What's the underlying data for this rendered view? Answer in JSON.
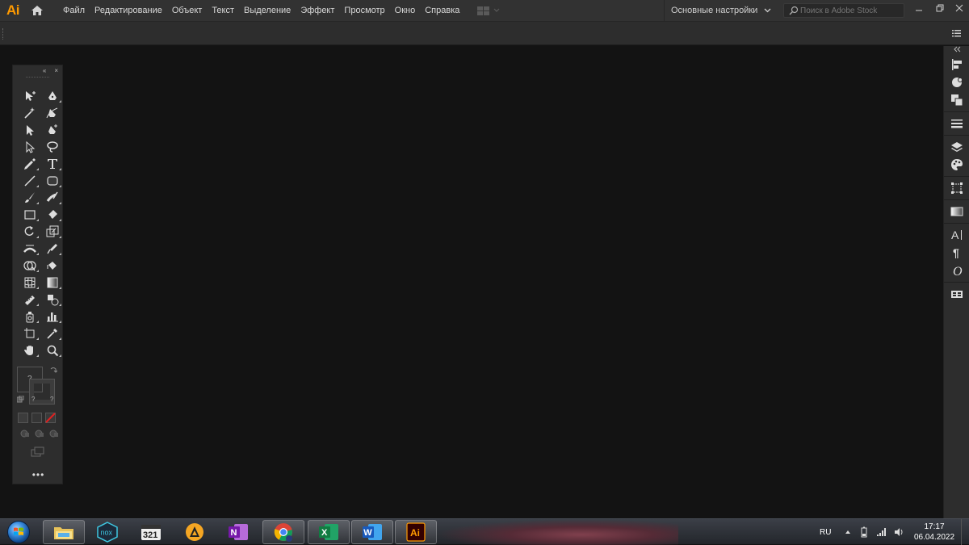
{
  "app": {
    "logo": "Ai",
    "menu": [
      "Файл",
      "Редактирование",
      "Объект",
      "Текст",
      "Выделение",
      "Эффект",
      "Просмотр",
      "Окно",
      "Справка"
    ],
    "workspace_label": "Основные настройки",
    "stock_search_placeholder": "Поиск в Adobe Stock",
    "window_controls": [
      "minimize",
      "restore",
      "close"
    ]
  },
  "tools": {
    "header_collapse": "«",
    "header_close": "×",
    "rows": [
      [
        "selection-tool-icon",
        "pen-tool-icon"
      ],
      [
        "magic-wand-tool-icon",
        "curvature-tool-icon"
      ],
      [
        "direct-selection-tool-icon",
        "add-anchor-point-tool-icon"
      ],
      [
        "group-selection-tool-icon",
        "lasso-tool-icon"
      ],
      [
        "pencil-tool-icon",
        "type-tool-icon"
      ],
      [
        "line-segment-tool-icon",
        "rounded-rectangle-tool-icon"
      ],
      [
        "paintbrush-tool-icon",
        "blob-brush-tool-icon"
      ],
      [
        "rectangle-tool-icon",
        "eraser-tool-icon"
      ],
      [
        "rotate-tool-icon",
        "scale-tool-icon"
      ],
      [
        "width-tool-icon",
        "puppet-warp-tool-icon"
      ],
      [
        "shape-builder-tool-icon",
        "live-paint-bucket-tool-icon"
      ],
      [
        "mesh-tool-icon",
        "gradient-tool-icon"
      ],
      [
        "measure-tool-icon",
        "blend-tool-icon"
      ],
      [
        "symbol-sprayer-tool-icon",
        "column-graph-tool-icon"
      ],
      [
        "artboard-tool-icon",
        "eyedropper-tool-icon"
      ],
      [
        "hand-tool-icon",
        "zoom-tool-icon"
      ]
    ],
    "fill_placeholder": "?",
    "stroke_placeholder": "?",
    "more_label": "•••"
  },
  "taskbar": {
    "apps": [
      "windows-explorer",
      "nox",
      "media-player-321",
      "aimp",
      "onenote",
      "chrome",
      "excel",
      "word",
      "illustrator"
    ],
    "active_app": "illustrator",
    "language": "RU",
    "time": "17:17",
    "date": "06.04.2022"
  }
}
